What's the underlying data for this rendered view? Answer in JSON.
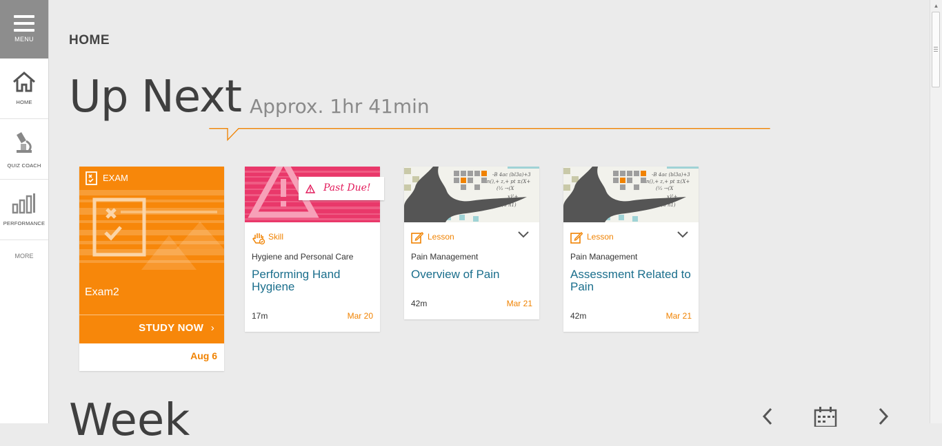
{
  "sidebar": {
    "menu_label": "MENU",
    "items": [
      {
        "label": "HOME",
        "icon": "home-icon"
      },
      {
        "label": "QUIZ COACH",
        "icon": "microscope-icon"
      },
      {
        "label": "PERFORMANCE",
        "icon": "bar-chart-icon"
      }
    ],
    "more_label": "MORE"
  },
  "header": {
    "page_title": "HOME",
    "up_next_title": "Up Next",
    "approx_time": "Approx. 1hr 41min"
  },
  "colors": {
    "accent_orange": "#f7870a",
    "link_teal": "#1a6e8c",
    "past_due_pink": "#e2195a"
  },
  "exam_card": {
    "type_label": "EXAM",
    "name": "Exam2",
    "action_label": "STUDY NOW",
    "due_date": "Aug 6"
  },
  "cards": [
    {
      "type_label": "Skill",
      "type_icon": "hand-icon",
      "badge": "Past Due!",
      "course": "Hygiene and Personal Care",
      "title": "Performing Hand Hygiene",
      "duration": "17m",
      "due_date": "Mar 20"
    },
    {
      "type_label": "Lesson",
      "type_icon": "edit-icon",
      "course": "Pain Management",
      "title": "Overview of Pain",
      "duration": "42m",
      "due_date": "Mar 21"
    },
    {
      "type_label": "Lesson",
      "type_icon": "edit-icon",
      "course": "Pain Management",
      "title": "Assessment Related to Pain",
      "duration": "42m",
      "due_date": "Mar 21"
    }
  ],
  "week": {
    "title": "Week"
  }
}
